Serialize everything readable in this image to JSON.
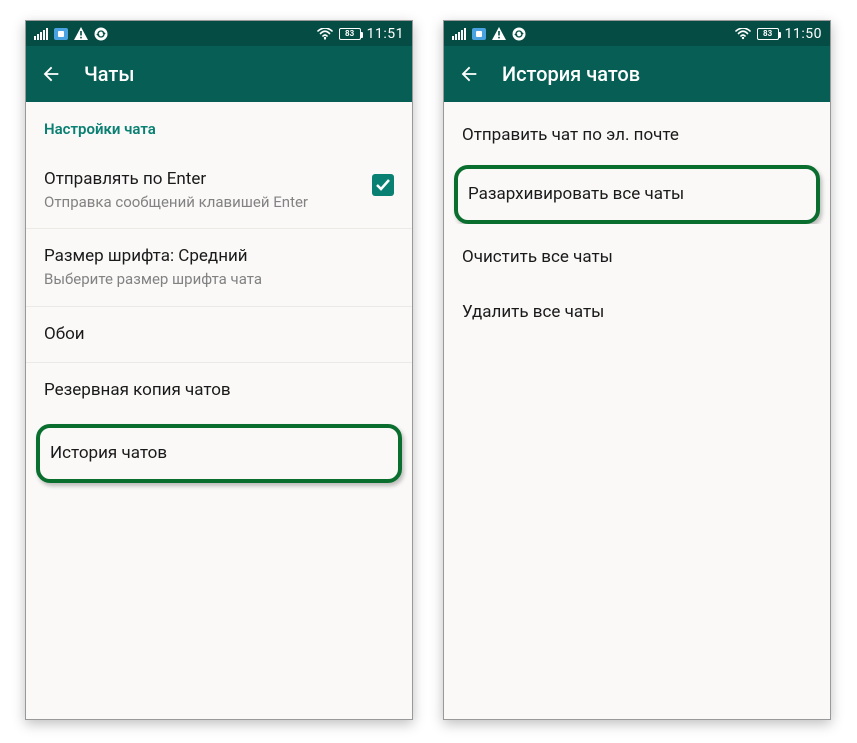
{
  "left": {
    "status": {
      "battery": "83",
      "time": "11:51"
    },
    "appbar_title": "Чаты",
    "section_header": "Настройки чата",
    "items": {
      "enter": {
        "title": "Отправлять по Enter",
        "sub": "Отправка сообщений клавишей Enter"
      },
      "font": {
        "title": "Размер шрифта: Средний",
        "sub": "Выберите размер шрифта чата"
      },
      "wallpaper": {
        "title": "Обои"
      },
      "backup": {
        "title": "Резервная копия чатов"
      },
      "history": {
        "title": "История чатов"
      }
    }
  },
  "right": {
    "status": {
      "battery": "83",
      "time": "11:50"
    },
    "appbar_title": "История чатов",
    "items": {
      "email": {
        "title": "Отправить чат по эл. почте"
      },
      "unarchive": {
        "title": "Разархивировать все чаты"
      },
      "clear": {
        "title": "Очистить все чаты"
      },
      "delete": {
        "title": "Удалить все чаты"
      }
    }
  }
}
